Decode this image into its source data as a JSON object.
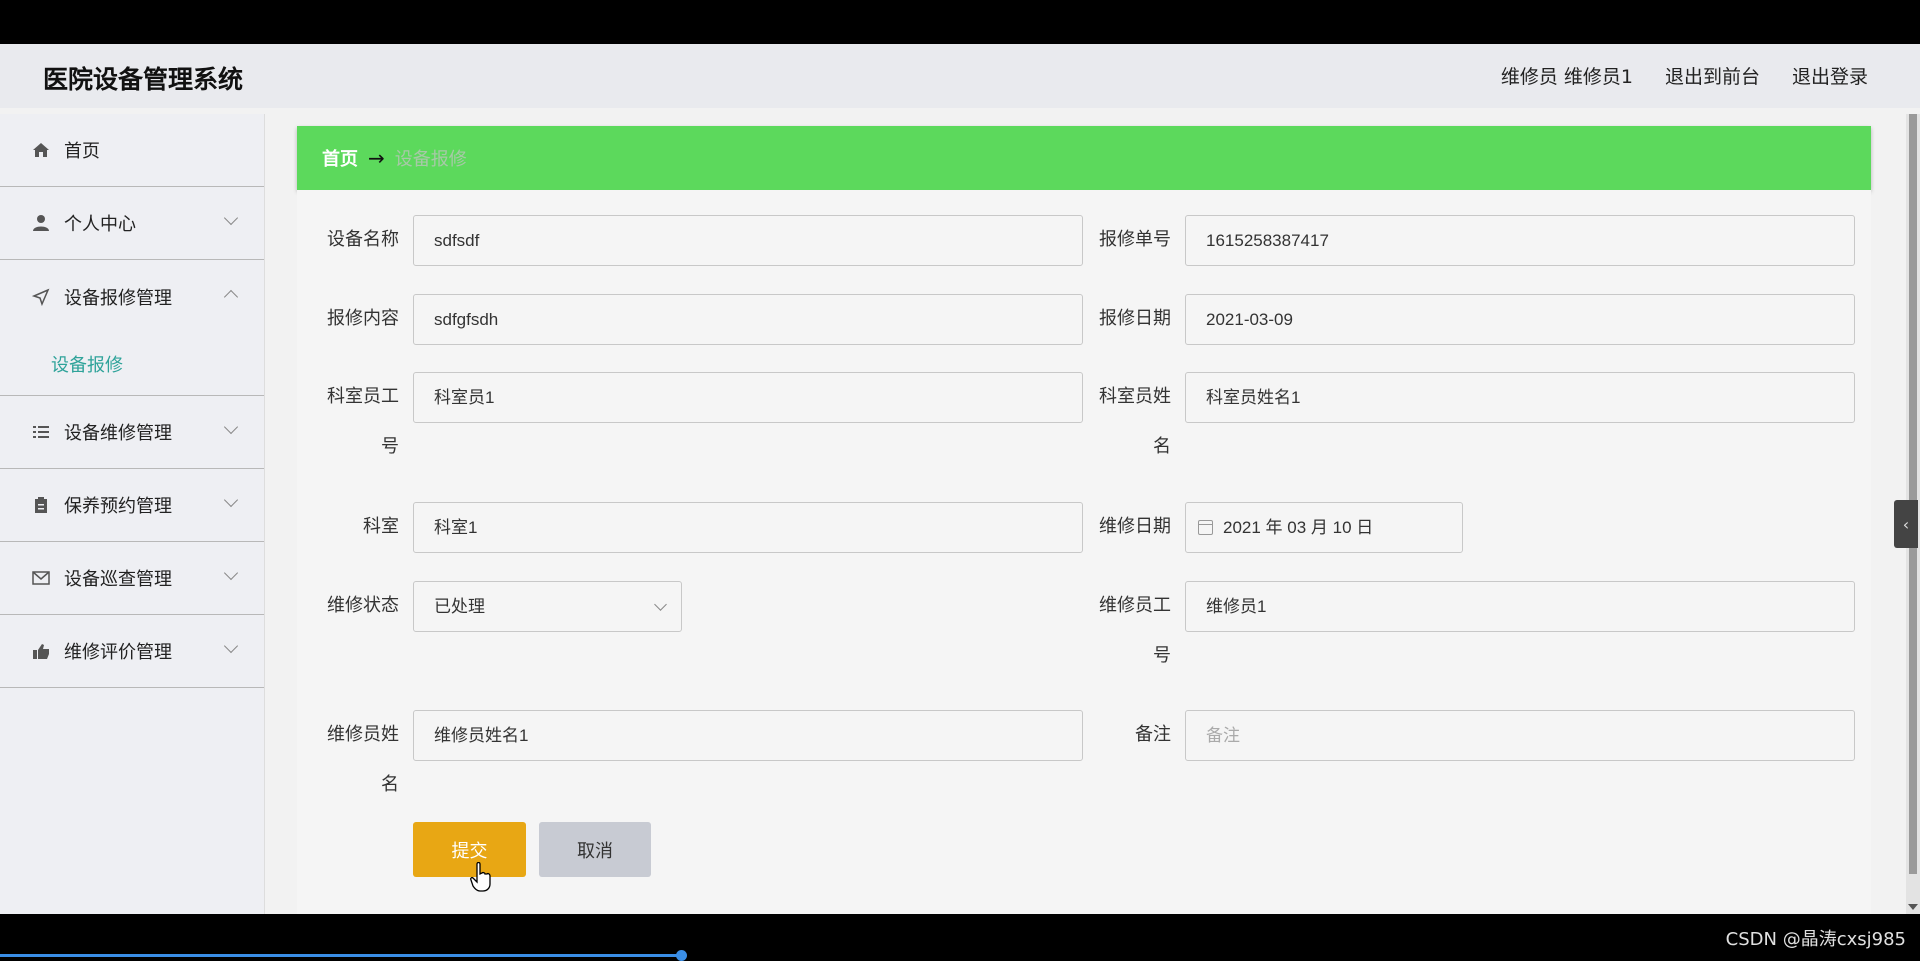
{
  "app": {
    "title": "医院设备管理系统",
    "user_label": "维修员 维修员1",
    "exit_front": "退出到前台",
    "logout": "退出登录"
  },
  "sidebar": {
    "home": "首页",
    "personal": "个人中心",
    "repair_mgmt": "设备报修管理",
    "repair_sub": "设备报修",
    "maintenance_mgmt": "设备维修管理",
    "upkeep_mgmt": "保养预约管理",
    "inspection_mgmt": "设备巡查管理",
    "evaluation_mgmt": "维修评价管理"
  },
  "breadcrumb": {
    "home": "首页",
    "arrow": "→",
    "current": "设备报修"
  },
  "form": {
    "device_name_label": "设备名称",
    "device_name": "sdfsdf",
    "order_no_label": "报修单号",
    "order_no": "1615258387417",
    "content_label": "报修内容",
    "content": "sdfgfsdh",
    "report_date_label": "报修日期",
    "report_date": "2021-03-09",
    "staff_no_label_1": "科室员工",
    "staff_no_label_2": "号",
    "staff_no": "科室员1",
    "staff_name_label_1": "科室员姓",
    "staff_name_label_2": "名",
    "staff_name": "科室员姓名1",
    "dept_label": "科室",
    "dept": "科室1",
    "repair_date_label": "维修日期",
    "repair_date": "2021 年 03 月 10 日",
    "status_label": "维修状态",
    "status": "已处理",
    "worker_no_label_1": "维修员工",
    "worker_no_label_2": "号",
    "worker_no": "维修员1",
    "worker_name_label_1": "维修员姓",
    "worker_name_label_2": "名",
    "worker_name": "维修员姓名1",
    "remark_label": "备注",
    "remark_placeholder": "备注",
    "submit": "提交",
    "cancel": "取消"
  },
  "misc": {
    "collapse": "‹",
    "watermark": "CSDN @晶涛cxsj985"
  },
  "colors": {
    "breadcrumb_bg": "#5cd95c",
    "submit_bg": "#e8a714",
    "active_sub": "#2fa39a"
  }
}
